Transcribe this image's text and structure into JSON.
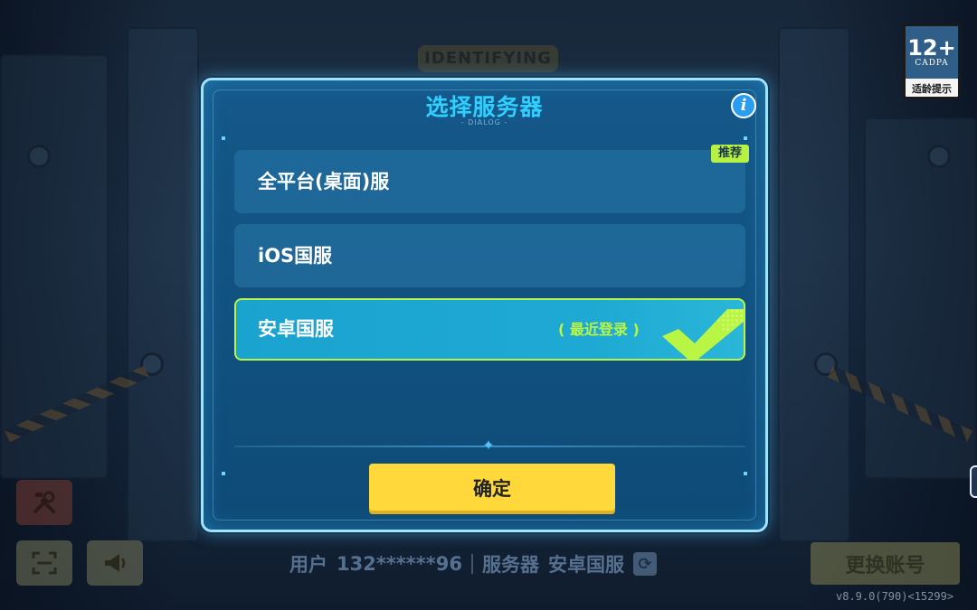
{
  "background": {
    "sign_text": "IDENTIFYING"
  },
  "age_rating": {
    "number": "12+",
    "org": "CADPA",
    "tip": "适龄提示"
  },
  "dialog": {
    "title": "选择服务器",
    "subtitle": "- DIALOG -",
    "info_icon": "i",
    "servers": [
      {
        "label": "全平台(桌面)服",
        "badge": "推荐",
        "selected": false
      },
      {
        "label": "iOS国服",
        "selected": false
      },
      {
        "label": "安卓国服",
        "tag": "( 最近登录 )",
        "selected": true
      }
    ],
    "divider_glyph": "✦",
    "confirm_label": "确定"
  },
  "status_bar": {
    "user_label": "用户",
    "user_id": "132******96",
    "server_label": "服务器",
    "server_value": "安卓国服",
    "refresh_icon": "⟳"
  },
  "switch_account_label": "更换账号",
  "version": "v8.9.0(790)<15299>",
  "icons": {
    "tools": "tools-icon",
    "scan": "scan-icon",
    "speaker": "speaker-icon",
    "info": "info-icon",
    "check": "check-icon"
  },
  "colors": {
    "accent_cyan": "#2fd0ff",
    "selected_border": "#b8f544",
    "confirm_yellow": "#ffd93b",
    "recommend_badge": "#b6f243"
  }
}
